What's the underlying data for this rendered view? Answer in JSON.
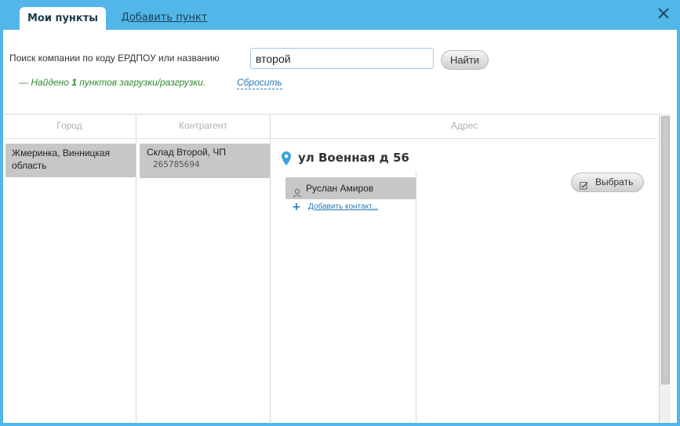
{
  "tabs": {
    "active_label": "Мои пункты",
    "add_label": "Добавить пункт"
  },
  "search": {
    "label": "Поиск компании по коду ЕРДПОУ или названию",
    "value": "второй",
    "button_label": "Найти"
  },
  "result": {
    "prefix": "— Найдено ",
    "count": "1",
    "suffix": " пунктов загрузки/разгрузки.",
    "reset_label": "Сбросить"
  },
  "table": {
    "headers": {
      "city": "Город",
      "counterparty": "Контрагент",
      "address": "Адрес"
    },
    "city": "Жмеринка, Винницкая область",
    "counterparty_name": "Склад Второй, ЧП",
    "counterparty_code": "265785694",
    "address": "ул Военная д 56",
    "contact": "Руслан Амиров",
    "add_contact_label": "Добавить контакт...",
    "select_label": "Выбрать"
  },
  "colors": {
    "frame": "#52b6e8",
    "found_text": "#2e8b2e",
    "link": "#2a78b5",
    "row_bg": "#c7c7c7"
  },
  "icons": [
    "close-icon",
    "map-pin-icon",
    "person-icon",
    "plus-icon",
    "checkbox-icon"
  ]
}
